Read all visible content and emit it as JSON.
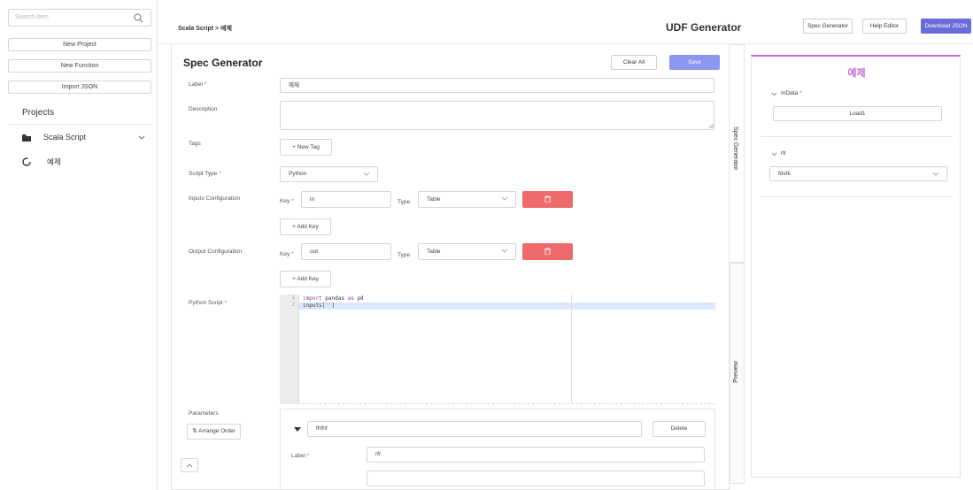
{
  "sidebar": {
    "search_placeholder": "Search Item",
    "buttons": [
      "New Project",
      "New Function",
      "Import JSON"
    ],
    "projects_title": "Projects",
    "folder_name": "Scala Script",
    "item_name": "예제"
  },
  "topbar": {
    "breadcrumb": "Scala Script > 예제",
    "app_title": "UDF Generator",
    "buttons": {
      "spec_generator": "Spec Generator",
      "help_editor": "Help Editor",
      "download_json": "Download JSON"
    }
  },
  "spec": {
    "title": "Spec Generator",
    "clear_all": "Clear All",
    "save": "Save",
    "required_mark": "*",
    "label": {
      "label": "Label",
      "value": "예제"
    },
    "description": {
      "label": "Description",
      "value": ""
    },
    "tags": {
      "label": "Tags",
      "new_tag": "+ New Tag"
    },
    "script_type": {
      "label": "Script Type",
      "value": "Python"
    },
    "inputs": {
      "label": "Inputs Configuration",
      "key_label": "Key",
      "key_value": "in",
      "type_label": "Type",
      "type_value": "Table",
      "add_key": "+ Add Key"
    },
    "outputs": {
      "label": "Output Configuration",
      "key_label": "Key",
      "key_value": "out",
      "type_label": "Type",
      "type_value": "Table",
      "add_key": "+ Add Key"
    },
    "script": {
      "label": "Python Script",
      "line_numbers": [
        "1",
        "2"
      ],
      "line1": {
        "kw1": "import",
        "mod": " pandas ",
        "kw2": "as",
        "alias": " pd"
      },
      "line2": "inputs['']"
    },
    "parameters": {
      "label": "Parameters",
      "arrange_order": "Arrange Order",
      "param_name": "fhfhf",
      "delete": "Delete",
      "label_field": "Label",
      "label_value": "rfr"
    }
  },
  "tabs": {
    "spec_generator": "Spec Generator",
    "preview": "Preview"
  },
  "preview": {
    "title": "예제",
    "indata_label": "InData",
    "indata_value": "Load1",
    "rfr_label": "rfr",
    "rfr_value": "fdsfk"
  },
  "colors": {
    "accent": "#6b6bdc",
    "save": "#8d96ee",
    "delete": "#ef6b6b",
    "preview_title": "#c56ad6",
    "required": "#e0555a"
  }
}
